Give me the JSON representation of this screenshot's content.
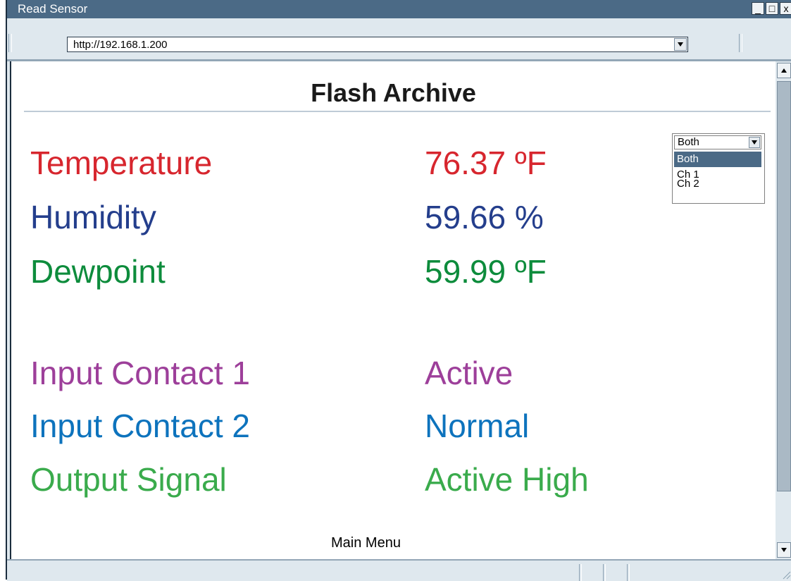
{
  "window": {
    "title": "Read Sensor",
    "controls": {
      "minimize": "_",
      "maximize": "□",
      "close": "x"
    }
  },
  "address": {
    "url": "http://192.168.1.200"
  },
  "page": {
    "title": "Flash Archive",
    "readings": [
      {
        "label": "Temperature",
        "value": "76.37 ºF",
        "color": "#d7262e"
      },
      {
        "label": "Humidity",
        "value": "59.66 %",
        "color": "#243e8c"
      },
      {
        "label": "Dewpoint",
        "value": "59.99 ºF",
        "color": "#0d8c3c"
      }
    ],
    "statuses": [
      {
        "label": "Input Contact 1",
        "value": "Active",
        "color": "#9d3f9a"
      },
      {
        "label": "Input Contact 2",
        "value": "Normal",
        "color": "#0d73bd"
      },
      {
        "label": "Output Signal",
        "value": "Active High",
        "color": "#3aab4c"
      }
    ],
    "channel_select": {
      "selected": "Both",
      "options": [
        "Both",
        "Ch 1",
        "Ch 2"
      ]
    },
    "footer_link": "Main Menu"
  }
}
